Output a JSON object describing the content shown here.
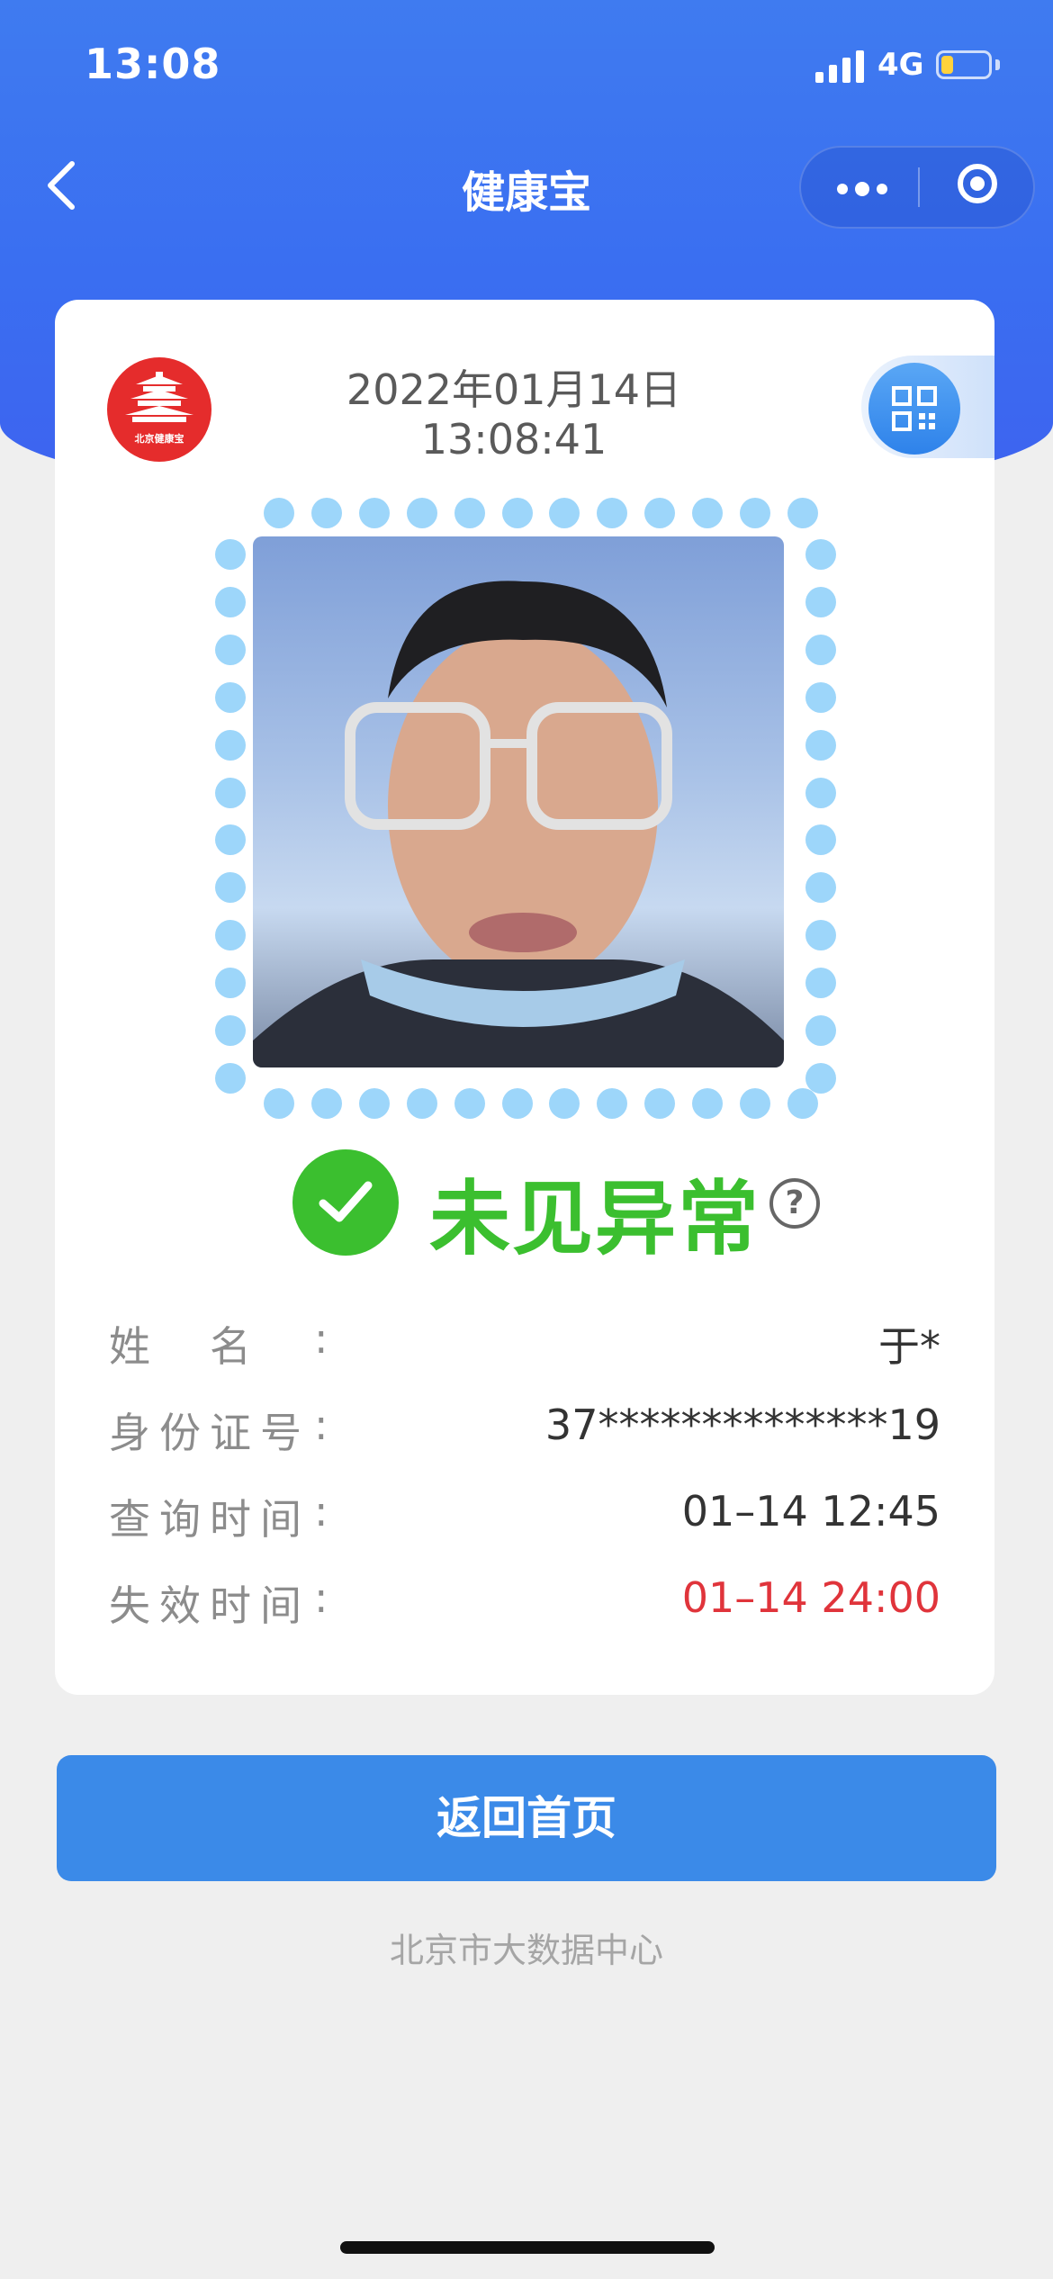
{
  "status_bar": {
    "time": "13:08",
    "network": "4G",
    "battery_level": 0.25
  },
  "nav": {
    "title": "健康宝",
    "back_icon": "chevron-left-icon",
    "more_icon": "more-dots-icon",
    "target_icon": "target-icon"
  },
  "card": {
    "logo_text": "北京健康宝",
    "date": "2022年01月14日",
    "time": "13:08:41",
    "qr_icon": "qr-code-icon",
    "status": {
      "text": "未见异常",
      "color": "#3bbf2f",
      "help": "?"
    },
    "info": [
      {
        "label": "姓　名",
        "value": "于*"
      },
      {
        "label": "身份证号",
        "value": "37**************19"
      },
      {
        "label": "查询时间",
        "value": "01–14 12:45"
      },
      {
        "label": "失效时间",
        "value": "01–14 24:00",
        "value_color": "#e0343b"
      }
    ],
    "colon": ":"
  },
  "home_button_label": "返回首页",
  "footer": "北京市大数据中心",
  "colors": {
    "primary": "#3b8ae8",
    "header": "#3f7bf0",
    "dots": "#9dd6fa"
  }
}
